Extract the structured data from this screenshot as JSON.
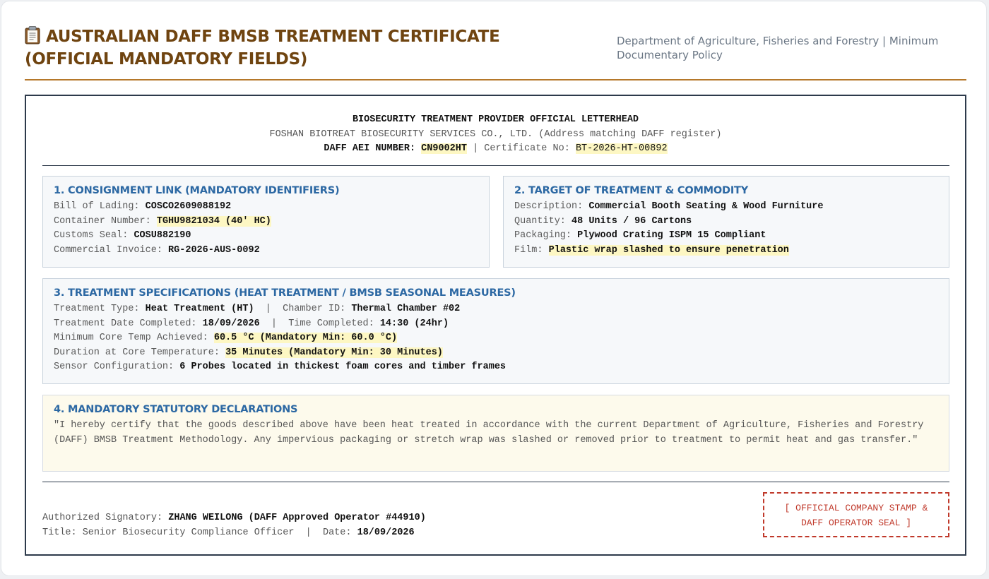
{
  "header": {
    "title": "AUSTRALIAN DAFF BMSB TREATMENT CERTIFICATE (OFFICIAL MANDATORY FIELDS)",
    "title_icon": "clipboard-icon",
    "department": "Department of Agriculture, Fisheries and Forestry | Minimum Documentary Policy"
  },
  "letterhead": {
    "title": "BIOSECURITY TREATMENT PROVIDER OFFICIAL LETTERHEAD",
    "company": "FOSHAN BIOTREAT BIOSECURITY SERVICES CO., LTD. (Address matching DAFF register)",
    "aei_label": "DAFF AEI NUMBER:",
    "aei_value": "CN9002HT",
    "divider": "|",
    "cert_label": "Certificate No:",
    "cert_value": "BT-2026-HT-00892"
  },
  "consignment": {
    "title": "1. CONSIGNMENT LINK (MANDATORY IDENTIFIERS)",
    "bol_label": "Bill of Lading:",
    "bol_value": "COSCO2609088192",
    "container_label": "Container Number:",
    "container_value": "TGHU9821034 (40' HC)",
    "seal_label": "Customs Seal:",
    "seal_value": "COSU882190",
    "invoice_label": "Commercial Invoice:",
    "invoice_value": "RG-2026-AUS-0092"
  },
  "target": {
    "title": "2. TARGET OF TREATMENT & COMMODITY",
    "desc_label": "Description:",
    "desc_value": "Commercial Booth Seating & Wood Furniture",
    "qty_label": "Quantity:",
    "qty_value": "48 Units / 96 Cartons",
    "pack_label": "Packaging:",
    "pack_value": "Plywood Crating ISPM 15 Compliant",
    "film_label": "Film:",
    "film_value": "Plastic wrap slashed to ensure penetration"
  },
  "specs": {
    "title": "3. TREATMENT SPECIFICATIONS (HEAT TREATMENT / BMSB SEASONAL MEASURES)",
    "type_label": "Treatment Type:",
    "type_value": "Heat Treatment (HT)",
    "sep": "|",
    "chamber_label": "Chamber ID:",
    "chamber_value": "Thermal Chamber #02",
    "date_label": "Treatment Date Completed:",
    "date_value": "18/09/2026",
    "time_label": "Time Completed:",
    "time_value": "14:30 (24hr)",
    "temp_label": "Minimum Core Temp Achieved:",
    "temp_value": "60.5 °C (Mandatory Min: 60.0 °C)",
    "duration_label": "Duration at Core Temperature:",
    "duration_value": "35 Minutes (Mandatory Min: 30 Minutes)",
    "sensor_label": "Sensor Configuration:",
    "sensor_value": "6 Probes located in thickest foam cores and timber frames"
  },
  "declarations": {
    "title": "4. MANDATORY STATUTORY DECLARATIONS",
    "text": "\"I hereby certify that the goods described above have been heat treated in accordance with the current Department of Agriculture, Fisheries and Forestry (DAFF) BMSB Treatment Methodology. Any impervious packaging or stretch wrap was slashed or removed prior to treatment to permit heat and gas transfer.\""
  },
  "signature": {
    "signatory_label": "Authorized Signatory:",
    "signatory_value": "ZHANG WEILONG (DAFF Approved Operator #44910)",
    "title_label": "Title: Senior Biosecurity Compliance Officer",
    "sep": "|",
    "date_label": "Date:",
    "date_value": "18/09/2026"
  },
  "stamp": {
    "line1": "[ OFFICIAL COMPANY STAMP &",
    "line2": "DAFF OPERATOR SEAL ]"
  },
  "colors": {
    "title": "#6f4410",
    "header_rule": "#b5782a",
    "section_title": "#2c68a3",
    "highlight": "#fdf7c3",
    "stamp": "#c0392b",
    "border": "#2d3a4b"
  }
}
